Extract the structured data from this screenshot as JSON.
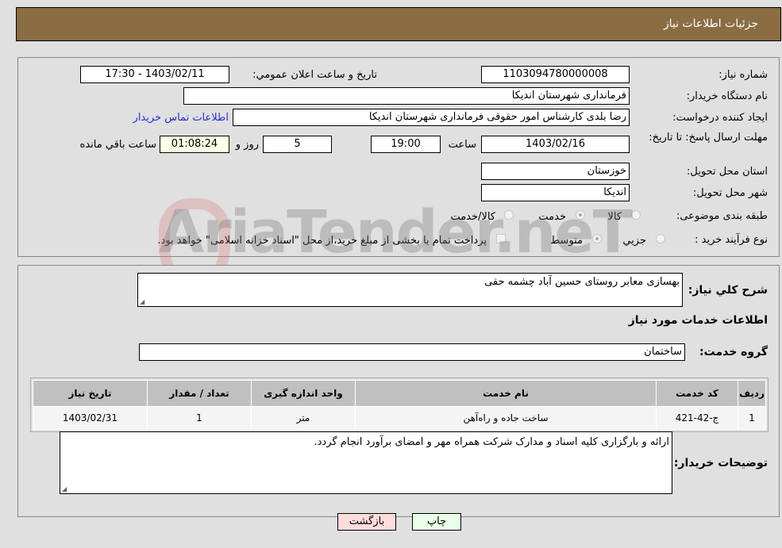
{
  "header": {
    "title": "جزئیات اطلاعات نیاز"
  },
  "form": {
    "need_number_label": "شماره نیاز:",
    "need_number": "1103094780000008",
    "announce_label": "تاریخ و ساعت اعلان عمومي:",
    "announce_value": "1403/02/11 - 17:30",
    "buyer_org_label": "نام دستگاه خریدار:",
    "buyer_org": "فرمانداری شهرستان اندیکا",
    "creator_label": "ایجاد کننده درخواست:",
    "creator": "رضا بلدی کارشناس امور حقوقی فرمانداری شهرستان اندیکا",
    "contact_link": "اطلاعات تماس خریدار",
    "deadline_label": "مهلت ارسال پاسخ: تا تاریخ:",
    "deadline_date": "1403/02/16",
    "time_label": "ساعت",
    "deadline_time": "19:00",
    "days_value": "5",
    "days_label": "روز و",
    "remaining_time": "01:08:24",
    "remaining_label": "ساعت باقي مانده",
    "province_label": "استان محل تحویل:",
    "province": "خوزستان",
    "city_label": "شهر محل تحویل:",
    "city": "اندیکا",
    "category_label": "طبقه بندی موضوعی:",
    "category_options": [
      "کالا",
      "خدمت",
      "کالا/خدمت"
    ],
    "category_selected": "خدمت",
    "process_label": "نوع فرآیند خرید :",
    "process_options": [
      "جزيي",
      "متوسط"
    ],
    "process_selected": "متوسط",
    "treasury_note": "پرداخت تمام یا بخشی از مبلغ خرید،از محل \"اسناد خزانه اسلامی\" خواهد بود."
  },
  "details": {
    "summary_label": "شرح کلي نیاز:",
    "summary": "بهسازی معابر روستای حسین آباد چشمه حقی",
    "services_title": "اطلاعات خدمات مورد نیاز",
    "group_label": "گروه خدمت:",
    "group_value": "ساختمان",
    "table": {
      "headers": [
        "ردیف",
        "کد خدمت",
        "نام خدمت",
        "واحد اندازه گیری",
        "تعداد / مقدار",
        "تاریخ نیاز"
      ],
      "rows": [
        [
          "1",
          "ج-42-421",
          "ساخت جاده و راه‌آهن",
          "متر",
          "1",
          "1403/02/31"
        ]
      ]
    },
    "buyer_notes_label": "توضیحات خریدار:",
    "buyer_notes": "ارائه و بارگزاری کلیه اسناد و مدارک شرکت همراه مهر و امضای برآورد انجام گردد."
  },
  "buttons": {
    "print": "چاپ",
    "back": "بازگشت"
  },
  "watermark": "AriaTender.neT",
  "colors": {
    "header_bg": "#8b6d43",
    "print_bg": "#eaffea",
    "back_bg": "#ffdcdc",
    "timer_bg": "#ffffe6"
  }
}
